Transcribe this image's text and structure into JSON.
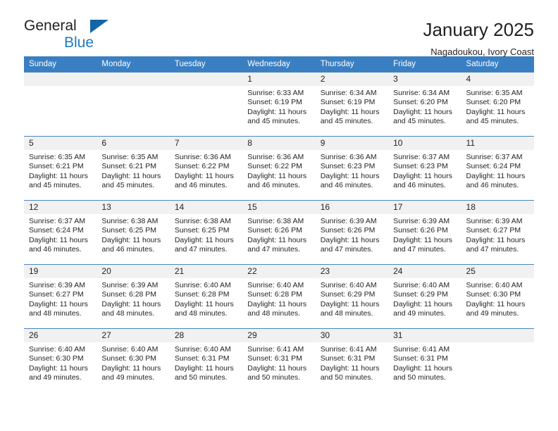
{
  "brand": {
    "name_part1": "General",
    "name_part2": "Blue",
    "triangle_color": "#1266a8",
    "blue_color": "#1f7bc1"
  },
  "header": {
    "title": "January 2025",
    "subtitle": "Nagadoukou, Ivory Coast"
  },
  "theme": {
    "header_row_bg": "#3a7fc1",
    "grid_line": "#4a86c5",
    "day_number_bg": "#f1f1f1",
    "text": "#231f20"
  },
  "weekdays": [
    "Sunday",
    "Monday",
    "Tuesday",
    "Wednesday",
    "Thursday",
    "Friday",
    "Saturday"
  ],
  "labels": {
    "sunrise_prefix": "Sunrise: ",
    "sunset_prefix": "Sunset: ",
    "daylight_prefix": "Daylight: "
  },
  "weeks": [
    [
      {
        "day": "",
        "sunrise": "",
        "sunset": "",
        "daylight_line1": "",
        "daylight_line2": ""
      },
      {
        "day": "",
        "sunrise": "",
        "sunset": "",
        "daylight_line1": "",
        "daylight_line2": ""
      },
      {
        "day": "",
        "sunrise": "",
        "sunset": "",
        "daylight_line1": "",
        "daylight_line2": ""
      },
      {
        "day": "1",
        "sunrise": "Sunrise: 6:33 AM",
        "sunset": "Sunset: 6:19 PM",
        "daylight_line1": "Daylight: 11 hours",
        "daylight_line2": "and 45 minutes."
      },
      {
        "day": "2",
        "sunrise": "Sunrise: 6:34 AM",
        "sunset": "Sunset: 6:19 PM",
        "daylight_line1": "Daylight: 11 hours",
        "daylight_line2": "and 45 minutes."
      },
      {
        "day": "3",
        "sunrise": "Sunrise: 6:34 AM",
        "sunset": "Sunset: 6:20 PM",
        "daylight_line1": "Daylight: 11 hours",
        "daylight_line2": "and 45 minutes."
      },
      {
        "day": "4",
        "sunrise": "Sunrise: 6:35 AM",
        "sunset": "Sunset: 6:20 PM",
        "daylight_line1": "Daylight: 11 hours",
        "daylight_line2": "and 45 minutes."
      }
    ],
    [
      {
        "day": "5",
        "sunrise": "Sunrise: 6:35 AM",
        "sunset": "Sunset: 6:21 PM",
        "daylight_line1": "Daylight: 11 hours",
        "daylight_line2": "and 45 minutes."
      },
      {
        "day": "6",
        "sunrise": "Sunrise: 6:35 AM",
        "sunset": "Sunset: 6:21 PM",
        "daylight_line1": "Daylight: 11 hours",
        "daylight_line2": "and 45 minutes."
      },
      {
        "day": "7",
        "sunrise": "Sunrise: 6:36 AM",
        "sunset": "Sunset: 6:22 PM",
        "daylight_line1": "Daylight: 11 hours",
        "daylight_line2": "and 46 minutes."
      },
      {
        "day": "8",
        "sunrise": "Sunrise: 6:36 AM",
        "sunset": "Sunset: 6:22 PM",
        "daylight_line1": "Daylight: 11 hours",
        "daylight_line2": "and 46 minutes."
      },
      {
        "day": "9",
        "sunrise": "Sunrise: 6:36 AM",
        "sunset": "Sunset: 6:23 PM",
        "daylight_line1": "Daylight: 11 hours",
        "daylight_line2": "and 46 minutes."
      },
      {
        "day": "10",
        "sunrise": "Sunrise: 6:37 AM",
        "sunset": "Sunset: 6:23 PM",
        "daylight_line1": "Daylight: 11 hours",
        "daylight_line2": "and 46 minutes."
      },
      {
        "day": "11",
        "sunrise": "Sunrise: 6:37 AM",
        "sunset": "Sunset: 6:24 PM",
        "daylight_line1": "Daylight: 11 hours",
        "daylight_line2": "and 46 minutes."
      }
    ],
    [
      {
        "day": "12",
        "sunrise": "Sunrise: 6:37 AM",
        "sunset": "Sunset: 6:24 PM",
        "daylight_line1": "Daylight: 11 hours",
        "daylight_line2": "and 46 minutes."
      },
      {
        "day": "13",
        "sunrise": "Sunrise: 6:38 AM",
        "sunset": "Sunset: 6:25 PM",
        "daylight_line1": "Daylight: 11 hours",
        "daylight_line2": "and 46 minutes."
      },
      {
        "day": "14",
        "sunrise": "Sunrise: 6:38 AM",
        "sunset": "Sunset: 6:25 PM",
        "daylight_line1": "Daylight: 11 hours",
        "daylight_line2": "and 47 minutes."
      },
      {
        "day": "15",
        "sunrise": "Sunrise: 6:38 AM",
        "sunset": "Sunset: 6:26 PM",
        "daylight_line1": "Daylight: 11 hours",
        "daylight_line2": "and 47 minutes."
      },
      {
        "day": "16",
        "sunrise": "Sunrise: 6:39 AM",
        "sunset": "Sunset: 6:26 PM",
        "daylight_line1": "Daylight: 11 hours",
        "daylight_line2": "and 47 minutes."
      },
      {
        "day": "17",
        "sunrise": "Sunrise: 6:39 AM",
        "sunset": "Sunset: 6:26 PM",
        "daylight_line1": "Daylight: 11 hours",
        "daylight_line2": "and 47 minutes."
      },
      {
        "day": "18",
        "sunrise": "Sunrise: 6:39 AM",
        "sunset": "Sunset: 6:27 PM",
        "daylight_line1": "Daylight: 11 hours",
        "daylight_line2": "and 47 minutes."
      }
    ],
    [
      {
        "day": "19",
        "sunrise": "Sunrise: 6:39 AM",
        "sunset": "Sunset: 6:27 PM",
        "daylight_line1": "Daylight: 11 hours",
        "daylight_line2": "and 48 minutes."
      },
      {
        "day": "20",
        "sunrise": "Sunrise: 6:39 AM",
        "sunset": "Sunset: 6:28 PM",
        "daylight_line1": "Daylight: 11 hours",
        "daylight_line2": "and 48 minutes."
      },
      {
        "day": "21",
        "sunrise": "Sunrise: 6:40 AM",
        "sunset": "Sunset: 6:28 PM",
        "daylight_line1": "Daylight: 11 hours",
        "daylight_line2": "and 48 minutes."
      },
      {
        "day": "22",
        "sunrise": "Sunrise: 6:40 AM",
        "sunset": "Sunset: 6:28 PM",
        "daylight_line1": "Daylight: 11 hours",
        "daylight_line2": "and 48 minutes."
      },
      {
        "day": "23",
        "sunrise": "Sunrise: 6:40 AM",
        "sunset": "Sunset: 6:29 PM",
        "daylight_line1": "Daylight: 11 hours",
        "daylight_line2": "and 48 minutes."
      },
      {
        "day": "24",
        "sunrise": "Sunrise: 6:40 AM",
        "sunset": "Sunset: 6:29 PM",
        "daylight_line1": "Daylight: 11 hours",
        "daylight_line2": "and 49 minutes."
      },
      {
        "day": "25",
        "sunrise": "Sunrise: 6:40 AM",
        "sunset": "Sunset: 6:30 PM",
        "daylight_line1": "Daylight: 11 hours",
        "daylight_line2": "and 49 minutes."
      }
    ],
    [
      {
        "day": "26",
        "sunrise": "Sunrise: 6:40 AM",
        "sunset": "Sunset: 6:30 PM",
        "daylight_line1": "Daylight: 11 hours",
        "daylight_line2": "and 49 minutes."
      },
      {
        "day": "27",
        "sunrise": "Sunrise: 6:40 AM",
        "sunset": "Sunset: 6:30 PM",
        "daylight_line1": "Daylight: 11 hours",
        "daylight_line2": "and 49 minutes."
      },
      {
        "day": "28",
        "sunrise": "Sunrise: 6:40 AM",
        "sunset": "Sunset: 6:31 PM",
        "daylight_line1": "Daylight: 11 hours",
        "daylight_line2": "and 50 minutes."
      },
      {
        "day": "29",
        "sunrise": "Sunrise: 6:41 AM",
        "sunset": "Sunset: 6:31 PM",
        "daylight_line1": "Daylight: 11 hours",
        "daylight_line2": "and 50 minutes."
      },
      {
        "day": "30",
        "sunrise": "Sunrise: 6:41 AM",
        "sunset": "Sunset: 6:31 PM",
        "daylight_line1": "Daylight: 11 hours",
        "daylight_line2": "and 50 minutes."
      },
      {
        "day": "31",
        "sunrise": "Sunrise: 6:41 AM",
        "sunset": "Sunset: 6:31 PM",
        "daylight_line1": "Daylight: 11 hours",
        "daylight_line2": "and 50 minutes."
      },
      {
        "day": "",
        "sunrise": "",
        "sunset": "",
        "daylight_line1": "",
        "daylight_line2": ""
      }
    ]
  ]
}
